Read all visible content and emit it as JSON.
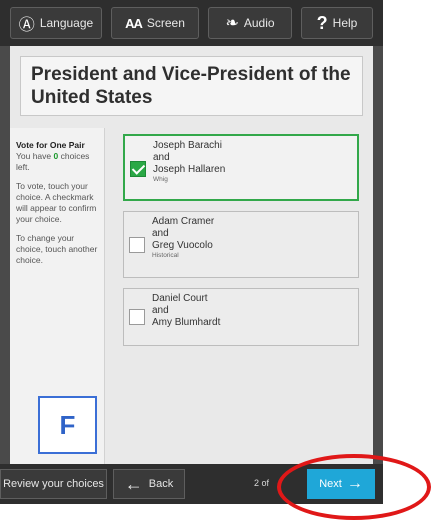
{
  "toolbar": {
    "language_label": "Language",
    "screen_label": "Screen",
    "screen_icon_text": "AA",
    "audio_label": "Audio",
    "help_label": "Help"
  },
  "contest": {
    "title": "President and Vice-President of the United States"
  },
  "instructions": {
    "vote_for": "Vote for One Pair",
    "you_have_prefix": "You have ",
    "choices_left_count": "0",
    "you_have_suffix": " choices left.",
    "how_to_vote": "To vote, touch your choice. A checkmark will appear to confirm your choice.",
    "how_to_change": "To change your choice, touch another choice."
  },
  "candidates": [
    {
      "line1": "Joseph Barachi",
      "and": "and",
      "line2": "Joseph Hallaren",
      "party": "Whig",
      "selected": true
    },
    {
      "line1": "Adam Cramer",
      "and": "and",
      "line2": "Greg Vuocolo",
      "party": "Historical",
      "selected": false
    },
    {
      "line1": "Daniel Court",
      "and": "and",
      "line2": "Amy Blumhardt",
      "party": "",
      "selected": false
    }
  ],
  "overlay": {
    "label_letter": "F",
    "label_border_color": "#3b6fd6",
    "highlight_color": "#e01818"
  },
  "footer": {
    "review_label": "Review your choices",
    "back_label": "Back",
    "page_info": "2 of",
    "next_label": "Next"
  },
  "colors": {
    "selected_border": "#32a84a",
    "next_button": "#1fa7d8",
    "choices_left": "#1d9a2e"
  }
}
